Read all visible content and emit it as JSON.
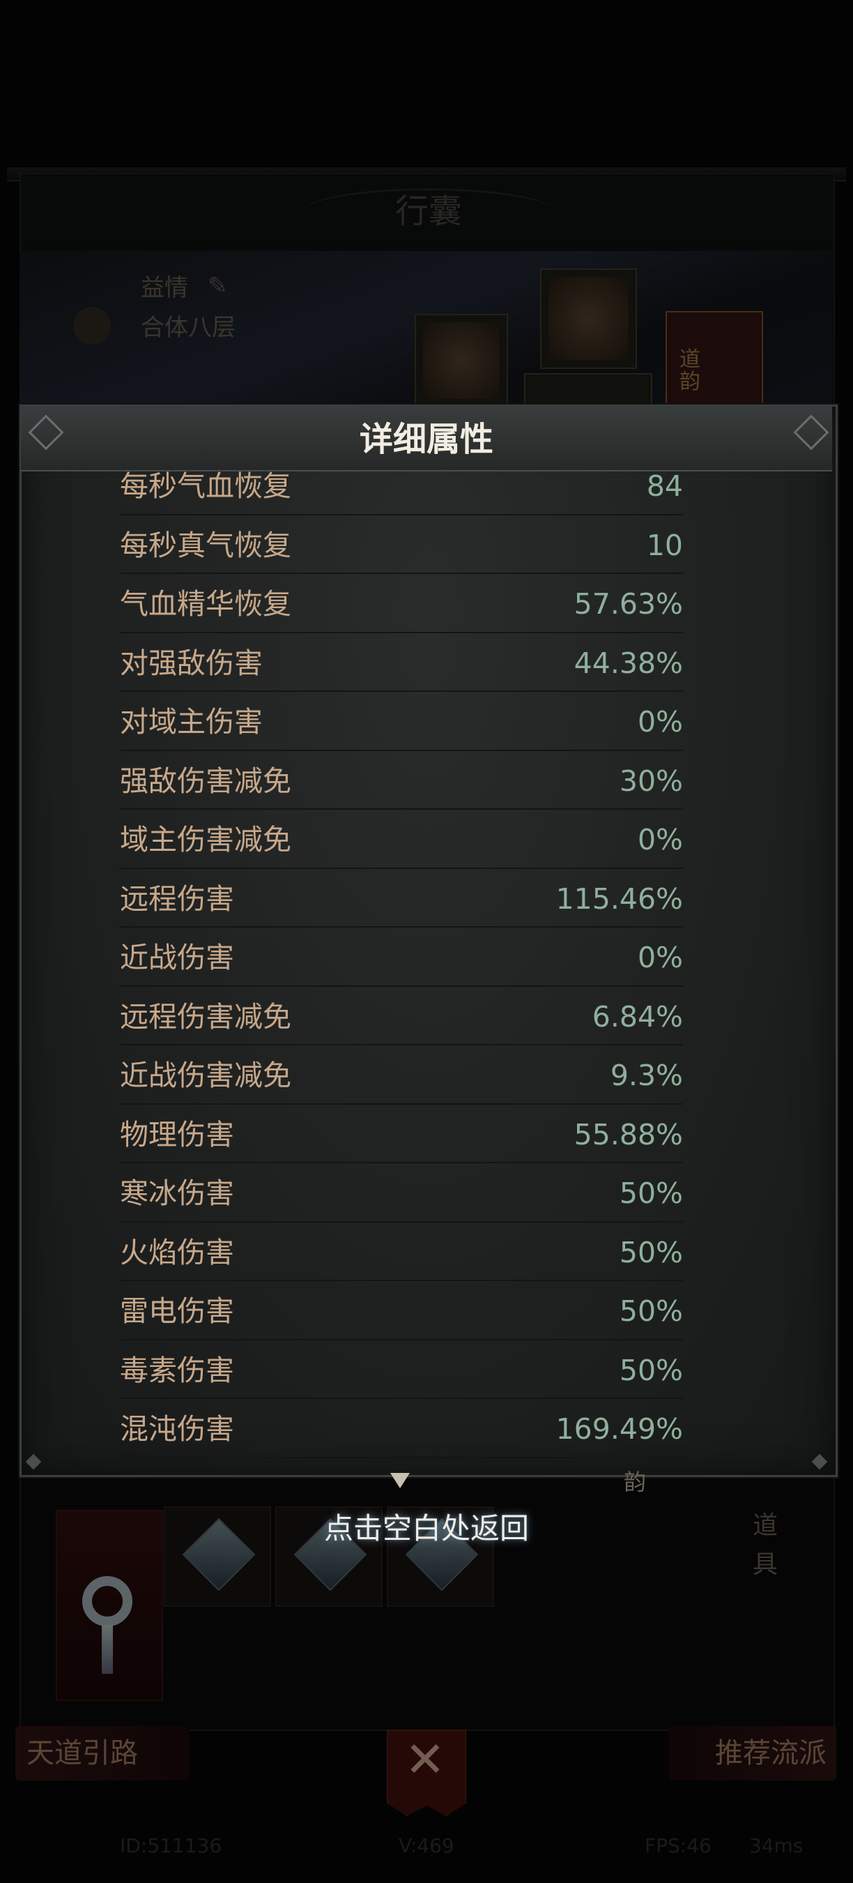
{
  "background": {
    "bag_title": "行囊",
    "character_name": "益情",
    "character_level": "合体八层",
    "dao_yun_label": "道\n韵",
    "dao_yun_bottom": "韵",
    "item_tab_label": "道\n具",
    "left_button": "天道引路",
    "right_button": "推荐流派",
    "footer": {
      "id": "ID:511136",
      "version": "V:469",
      "fps": "FPS:46",
      "latency": "34ms"
    }
  },
  "panel": {
    "title": "详细属性",
    "rows": [
      {
        "label": "每秒气血恢复",
        "value": "84"
      },
      {
        "label": "每秒真气恢复",
        "value": "10"
      },
      {
        "label": "气血精华恢复",
        "value": "57.63%"
      },
      {
        "label": "对强敌伤害",
        "value": "44.38%"
      },
      {
        "label": "对域主伤害",
        "value": "0%"
      },
      {
        "label": "强敌伤害减免",
        "value": "30%"
      },
      {
        "label": "域主伤害减免",
        "value": "0%"
      },
      {
        "label": "远程伤害",
        "value": "115.46%"
      },
      {
        "label": "近战伤害",
        "value": "0%"
      },
      {
        "label": "远程伤害减免",
        "value": "6.84%"
      },
      {
        "label": "近战伤害减免",
        "value": "9.3%"
      },
      {
        "label": "物理伤害",
        "value": "55.88%"
      },
      {
        "label": "寒冰伤害",
        "value": "50%"
      },
      {
        "label": "火焰伤害",
        "value": "50%"
      },
      {
        "label": "雷电伤害",
        "value": "50%"
      },
      {
        "label": "毒素伤害",
        "value": "50%"
      },
      {
        "label": "混沌伤害",
        "value": "169.49%"
      }
    ]
  },
  "hint": "点击空白处返回",
  "colors": {
    "label": "#c7a88a",
    "value": "#8fb09a",
    "title": "#f2ede2"
  }
}
